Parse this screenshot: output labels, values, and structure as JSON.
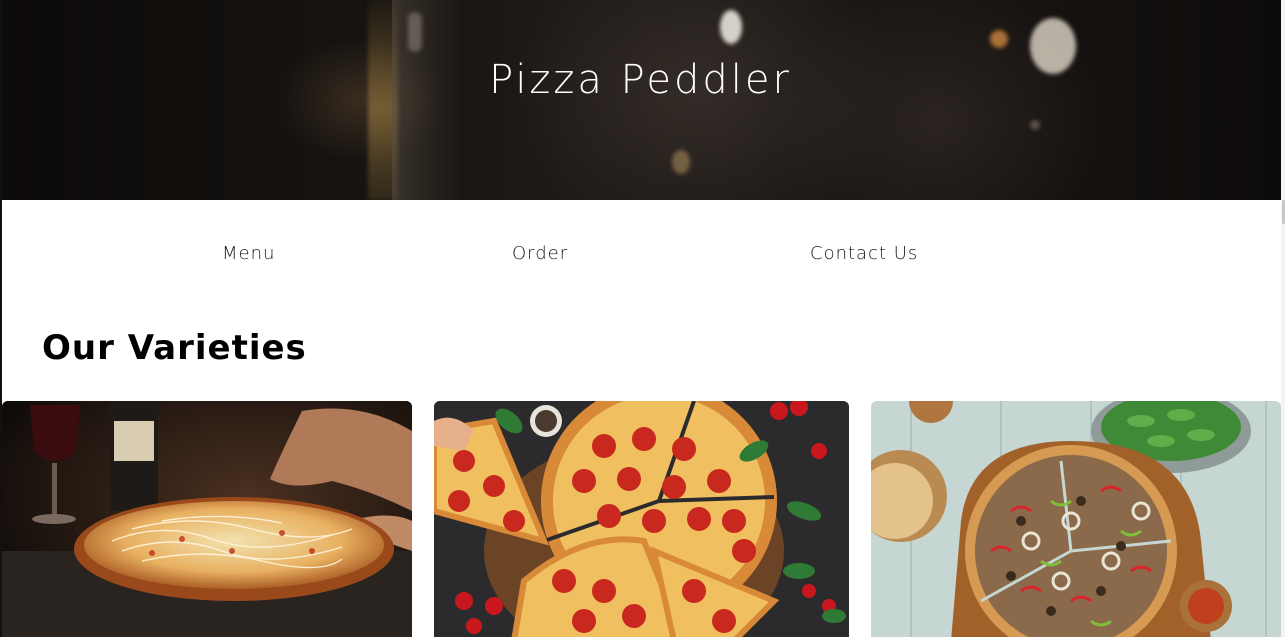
{
  "header": {
    "title": "Pizza Peddler"
  },
  "nav": {
    "items": [
      {
        "label": "Menu"
      },
      {
        "label": "Order"
      },
      {
        "label": "Contact Us"
      }
    ]
  },
  "main": {
    "section_title": "Our Varieties",
    "cards": [
      {
        "image": "cheese-pizza-with-wine-photo"
      },
      {
        "image": "pepperoni-pizza-photo"
      },
      {
        "image": "veggie-pizza-on-board-photo"
      }
    ]
  },
  "colors": {
    "page_background": "#ffffff",
    "hero_text": "#ffffff",
    "nav_text": "#1a1a1a",
    "heading_text": "#000000"
  }
}
